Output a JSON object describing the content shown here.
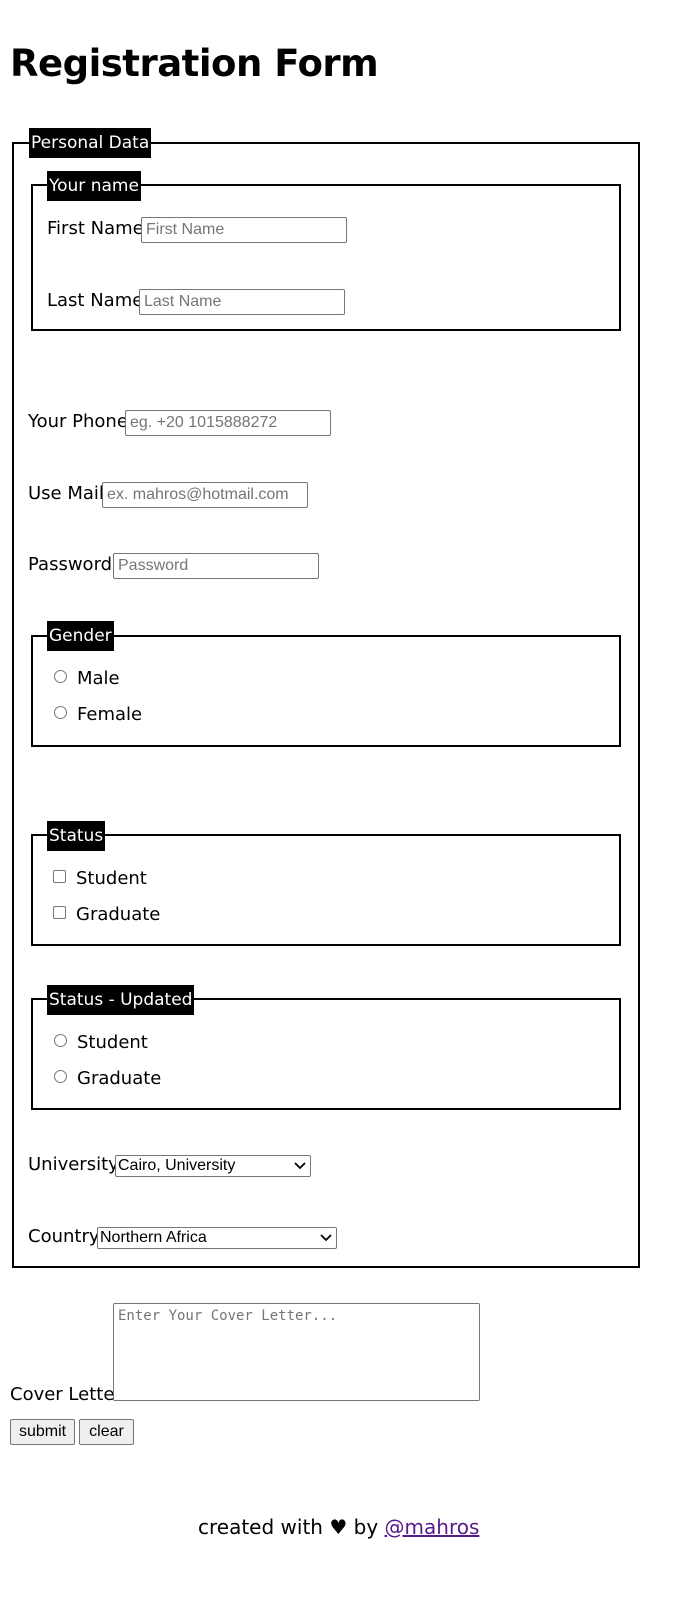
{
  "page": {
    "title": "Registration Form"
  },
  "personal_data": {
    "legend": "Personal Data",
    "name_group": {
      "legend": "Your name",
      "first_name_label": "First Name",
      "first_name_placeholder": "First Name",
      "last_name_label": "Last Name",
      "last_name_placeholder": "Last Name"
    },
    "phone_label": "Your Phone",
    "phone_placeholder": "eg. +20 1015888272",
    "mail_label": "Use Mail",
    "mail_placeholder": "ex. mahros@hotmail.com",
    "password_label": "Password",
    "password_placeholder": "Password",
    "gender": {
      "legend": "Gender",
      "options": [
        "Male",
        "Female"
      ]
    },
    "status": {
      "legend": "Status",
      "options": [
        "Student",
        "Graduate"
      ]
    },
    "status_updated": {
      "legend": "Status - Updated",
      "options": [
        "Student",
        "Graduate"
      ]
    },
    "university_label": "University",
    "university_selected": "Cairo, University",
    "country_label": "Country",
    "country_selected": "Northern Africa"
  },
  "cover_letter": {
    "label": "Cover Letter",
    "placeholder": "Enter Your Cover Letter..."
  },
  "buttons": {
    "submit": "submit",
    "clear": "clear"
  },
  "footer": {
    "text_before": "created with",
    "heart": "♥",
    "text_by": "by",
    "link": "@mahros"
  },
  "icons": {
    "select_arrow": "chevron-down-icon",
    "heart": "heart-icon"
  }
}
